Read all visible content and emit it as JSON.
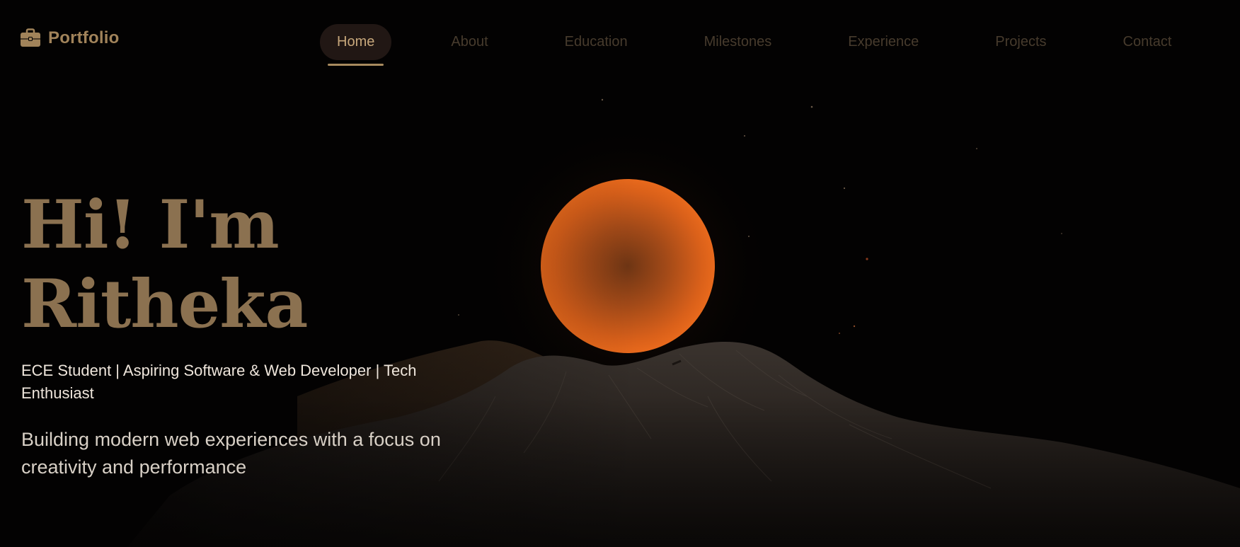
{
  "brand": {
    "icon": "briefcase-icon",
    "label": "Portfolio",
    "color": "#a1835a"
  },
  "nav": {
    "items": [
      {
        "label": "Home",
        "active": true
      },
      {
        "label": "About",
        "active": false
      },
      {
        "label": "Education",
        "active": false
      },
      {
        "label": "Milestones",
        "active": false
      },
      {
        "label": "Experience",
        "active": false
      },
      {
        "label": "Projects",
        "active": false
      },
      {
        "label": "Contact",
        "active": false
      }
    ]
  },
  "hero": {
    "greeting": "Hi! I'm",
    "name": "Ritheka",
    "role": "ECE Student | Aspiring Software & Web Developer | Tech Enthusiast",
    "description": "Building modern web experiences with a focus on creativity and performance"
  },
  "colors": {
    "background": "#030202",
    "accent": "#8b7150",
    "sun": "#e0621a",
    "mountain": "#2e2824"
  }
}
